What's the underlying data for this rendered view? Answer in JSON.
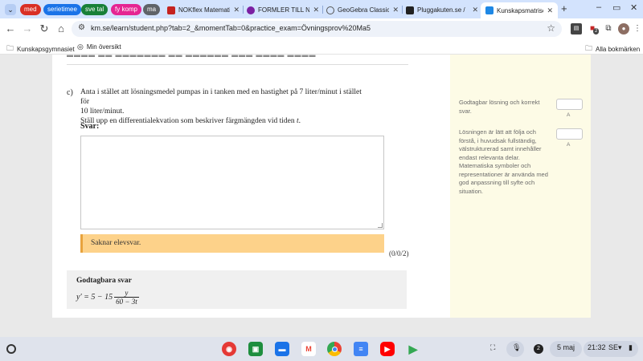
{
  "browser": {
    "tab_groups": [
      {
        "label": "med",
        "color": "#d93025"
      },
      {
        "label": "serietimee",
        "color": "#1a73e8"
      },
      {
        "label": "sve tal",
        "color": "#188038"
      },
      {
        "label": "fy komp",
        "color": "#e52592"
      },
      {
        "label": "ma",
        "color": "#5f6368"
      }
    ],
    "tabs": [
      {
        "title": "NOKflex Matemati",
        "favicon_color": "#c5221f"
      },
      {
        "title": "FORMLER TILL NA",
        "favicon_color": "#7b1fa2"
      },
      {
        "title": "GeoGebra Classic",
        "favicon_color": "#555555"
      },
      {
        "title": "Pluggakuten.se / ",
        "favicon_color": "#222222"
      }
    ],
    "active_tab": {
      "title": "Kunskapsmatriser",
      "favicon_color": "#1e88e5"
    },
    "url": "km.se/learn/student.php?tab=2_&momentTab=0&practice_exam=Övningsprov%20Ma5",
    "bookmarks": [
      {
        "label": "Kunskapsgymnasiet",
        "icon": "folder-icon"
      },
      {
        "label": "Min översikt",
        "icon": "globe-icon"
      }
    ],
    "all_bookmarks_label": "Alla bokmärken",
    "extension_badge": "2"
  },
  "question": {
    "letter": "c)",
    "line1": "Anta i stället att lösningsmedel pumpas in i tanken med en hastighet på 7 liter/minut i stället för",
    "line2": "10 liter/minut.",
    "line3_prefix": "Ställ upp en differentialekvation som beskriver färgmängden vid tiden ",
    "line3_var": "t",
    "line3_suffix": ".",
    "answer_label": "Svar:",
    "no_answer_text": "Saknar elevsvar.",
    "score": "(0/0/2)"
  },
  "solution": {
    "title": "Godtagbara svar",
    "lhs": "y′ = 5 − 15",
    "numerator": "y",
    "denominator": "60 − 3t"
  },
  "rubric": [
    {
      "text": "Godtagbar lösning och korrekt svar.",
      "level": "A"
    },
    {
      "text": "Lösningen är lätt att följa och förstå, i huvudsak fullständig, välstrukturerad samt innehåller endast relevanta delar. Matematiska symboler och representationer är använda med god anpassning till syfte och situation.",
      "level": "A"
    }
  ],
  "shelf": {
    "apps": [
      {
        "name": "chrome-icon",
        "color": "#e53935"
      },
      {
        "name": "classroom-icon",
        "color": "#1e8e3e"
      },
      {
        "name": "files-icon",
        "color": "#1a73e8"
      },
      {
        "name": "gmail-icon",
        "color": "#ea4335"
      },
      {
        "name": "chrome-browser-icon",
        "color": "#fbbc04"
      },
      {
        "name": "docs-icon",
        "color": "#4285f4"
      },
      {
        "name": "youtube-icon",
        "color": "#ff0000"
      },
      {
        "name": "play-store-icon",
        "color": "#34a853"
      }
    ],
    "notification_count": "2",
    "date": "5 maj",
    "time": "21:32",
    "locale": "SE"
  }
}
